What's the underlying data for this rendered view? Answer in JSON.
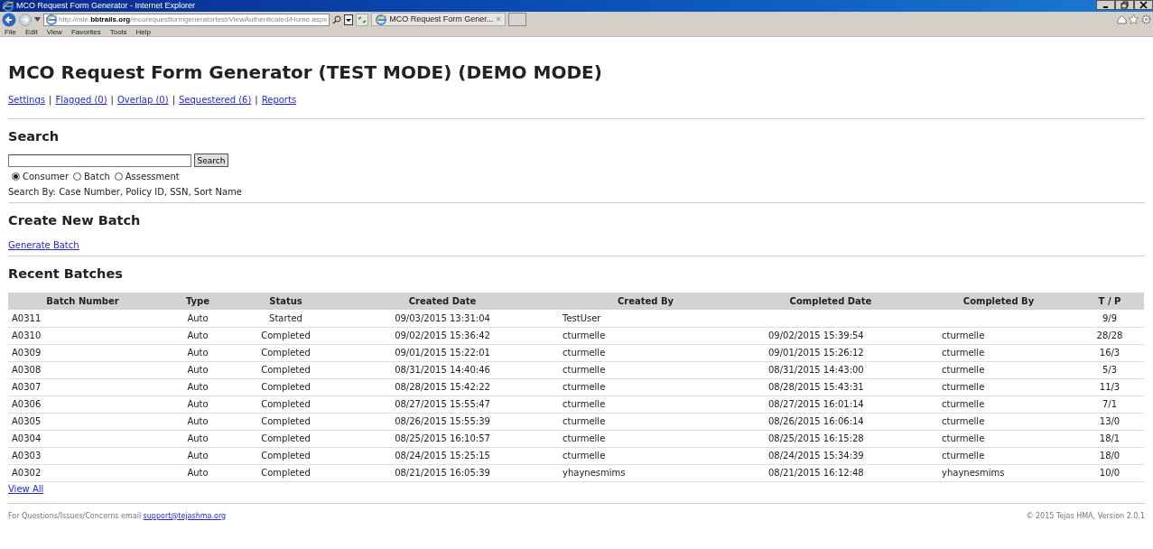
{
  "window": {
    "title": "MCO Request Form Generator - Internet Explorer",
    "address": "http://mle.**bbtrails.org**/mcorequestformgeneratortest/ViewAuthenticated/Home.aspx",
    "tab_title": "MCO Request Form Gener...",
    "tab_close": "×",
    "menu": [
      "File",
      "Edit",
      "View",
      "Favorites",
      "Tools",
      "Help"
    ]
  },
  "page": {
    "title": "MCO Request Form Generator (TEST MODE) (DEMO MODE)",
    "nav": [
      {
        "kind": "link",
        "text": "Settings"
      },
      {
        "kind": "separator",
        "text": "|"
      },
      {
        "kind": "link",
        "text": "Flagged (0)"
      },
      {
        "kind": "separator",
        "text": "|"
      },
      {
        "kind": "link",
        "text": "Overlap (0)"
      },
      {
        "kind": "separator",
        "text": "|"
      },
      {
        "kind": "link",
        "text": "Sequestered (6)"
      },
      {
        "kind": "separator",
        "text": "|"
      },
      {
        "kind": "link",
        "text": "Reports"
      }
    ],
    "search": {
      "heading": "Search",
      "button": "Search",
      "options": [
        {
          "label": "Consumer",
          "selected": true
        },
        {
          "label": "Batch",
          "selected": false
        },
        {
          "label": "Assessment",
          "selected": false
        }
      ],
      "hint": "Search By: Case Number, Policy ID, SSN, Sort Name"
    },
    "create": {
      "heading": "Create New Batch",
      "link": "Generate Batch"
    },
    "recent": {
      "heading": "Recent Batches",
      "columns": [
        "Batch Number",
        "Type",
        "Status",
        "Created Date",
        "Created By",
        "Completed Date",
        "Completed By",
        "T / P"
      ],
      "rows": [
        [
          "A0311",
          "Auto",
          "Started",
          "09/03/2015 13:31:04",
          "TestUser",
          "",
          "",
          "9/9"
        ],
        [
          "A0310",
          "Auto",
          "Completed",
          "09/02/2015 15:36:42",
          "cturmelle",
          "09/02/2015 15:39:54",
          "cturmelle",
          "28/28"
        ],
        [
          "A0309",
          "Auto",
          "Completed",
          "09/01/2015 15:22:01",
          "cturmelle",
          "09/01/2015 15:26:12",
          "cturmelle",
          "16/3"
        ],
        [
          "A0308",
          "Auto",
          "Completed",
          "08/31/2015 14:40:46",
          "cturmelle",
          "08/31/2015 14:43:00",
          "cturmelle",
          "5/3"
        ],
        [
          "A0307",
          "Auto",
          "Completed",
          "08/28/2015 15:42:22",
          "cturmelle",
          "08/28/2015 15:43:31",
          "cturmelle",
          "11/3"
        ],
        [
          "A0306",
          "Auto",
          "Completed",
          "08/27/2015 15:55:47",
          "cturmelle",
          "08/27/2015 16:01:14",
          "cturmelle",
          "7/1"
        ],
        [
          "A0305",
          "Auto",
          "Completed",
          "08/26/2015 15:55:39",
          "cturmelle",
          "08/26/2015 16:06:14",
          "cturmelle",
          "13/0"
        ],
        [
          "A0304",
          "Auto",
          "Completed",
          "08/25/2015 16:10:57",
          "cturmelle",
          "08/25/2015 16:15:28",
          "cturmelle",
          "18/1"
        ],
        [
          "A0303",
          "Auto",
          "Completed",
          "08/24/2015 15:25:15",
          "cturmelle",
          "08/24/2015 15:34:39",
          "cturmelle",
          "18/0"
        ],
        [
          "A0302",
          "Auto",
          "Completed",
          "08/21/2015 16:05:39",
          "yhaynesmims",
          "08/21/2015 16:12:48",
          "yhaynesmims",
          "10/0"
        ]
      ],
      "view_all": "View All"
    },
    "footer": {
      "text": "For Questions/Issues/Concerns email",
      "email": "support@tejashma.org",
      "copyright": "© 2015 Tejas HMA, Version 2.0.1"
    }
  }
}
